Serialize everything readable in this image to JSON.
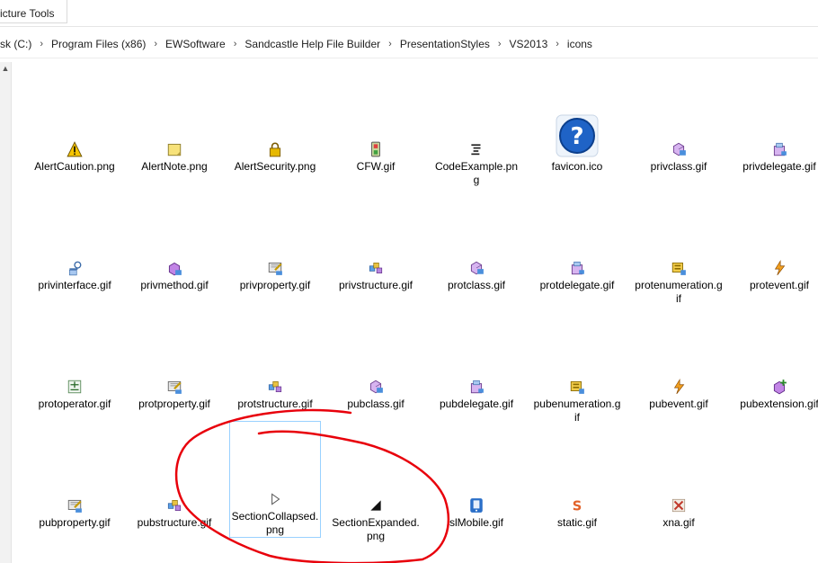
{
  "ribbon": {
    "tab_label": "icture Tools"
  },
  "breadcrumb": [
    "sk (C:)",
    "Program Files (x86)",
    "EWSoftware",
    "Sandcastle Help File Builder",
    "PresentationStyles",
    "VS2013",
    "icons"
  ],
  "files": [
    {
      "name": "AlertCaution.png",
      "icon": "warning-triangle-icon"
    },
    {
      "name": "AlertNote.png",
      "icon": "note-icon"
    },
    {
      "name": "AlertSecurity.png",
      "icon": "padlock-icon"
    },
    {
      "name": "CFW.gif",
      "icon": "device-icon"
    },
    {
      "name": "CodeExample.png",
      "icon": "code-lines-icon"
    },
    {
      "name": "favicon.ico",
      "icon": "help-question-icon"
    },
    {
      "name": "privclass.gif",
      "icon": "class-icon"
    },
    {
      "name": "privdelegate.gif",
      "icon": "delegate-icon"
    },
    {
      "name": "privinterface.gif",
      "icon": "interface-icon"
    },
    {
      "name": "privmethod.gif",
      "icon": "method-icon"
    },
    {
      "name": "privproperty.gif",
      "icon": "property-icon"
    },
    {
      "name": "privstructure.gif",
      "icon": "structure-icon"
    },
    {
      "name": "protclass.gif",
      "icon": "class-icon"
    },
    {
      "name": "protdelegate.gif",
      "icon": "delegate-icon"
    },
    {
      "name": "protenumeration.gif",
      "icon": "enumeration-icon"
    },
    {
      "name": "protevent.gif",
      "icon": "event-icon"
    },
    {
      "name": "protoperator.gif",
      "icon": "operator-icon"
    },
    {
      "name": "protproperty.gif",
      "icon": "property-icon"
    },
    {
      "name": "protstructure.gif",
      "icon": "structure-icon"
    },
    {
      "name": "pubclass.gif",
      "icon": "class-icon"
    },
    {
      "name": "pubdelegate.gif",
      "icon": "delegate-icon"
    },
    {
      "name": "pubenumeration.gif",
      "icon": "enumeration-icon"
    },
    {
      "name": "pubevent.gif",
      "icon": "event-icon"
    },
    {
      "name": "pubextension.gif",
      "icon": "extension-icon"
    },
    {
      "name": "pubproperty.gif",
      "icon": "property-icon"
    },
    {
      "name": "pubstructure.gif",
      "icon": "structure-icon"
    },
    {
      "name": "SectionCollapsed.png",
      "icon": "triangle-right-outline-icon",
      "selected": true
    },
    {
      "name": "SectionExpanded.png",
      "icon": "triangle-corner-filled-icon"
    },
    {
      "name": "slMobile.gif",
      "icon": "mobile-phone-icon"
    },
    {
      "name": "static.gif",
      "icon": "static-s-icon"
    },
    {
      "name": "xna.gif",
      "icon": "xna-icon"
    }
  ],
  "colors": {
    "selection_border": "#99d1ff",
    "annotation": "#e8000b"
  }
}
